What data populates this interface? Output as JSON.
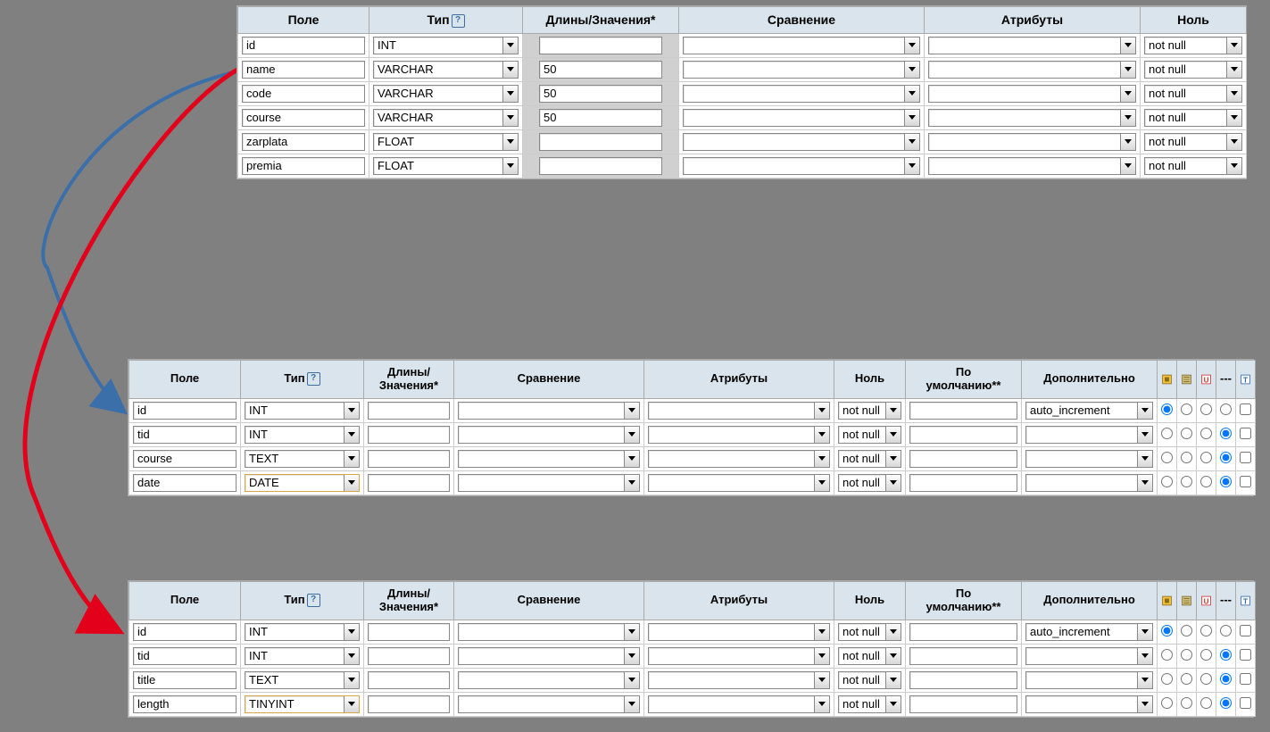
{
  "headers1": {
    "field": "Поле",
    "type": "Тип",
    "length": "Длины/Значения*",
    "collation": "Сравнение",
    "attributes": "Атрибуты",
    "null": "Ноль"
  },
  "headers2": {
    "field": "Поле",
    "type": "Тип",
    "length1": "Длины/",
    "length2": "Значения*",
    "collation": "Сравнение",
    "attributes": "Атрибуты",
    "null": "Ноль",
    "default1": "По",
    "default2": "умолчанию**",
    "extra": "Дополнительно",
    "dash": "---"
  },
  "table1": {
    "rows": [
      {
        "field": "id",
        "type": "INT",
        "length": "",
        "null": "not null"
      },
      {
        "field": "name",
        "type": "VARCHAR",
        "length": "50",
        "null": "not null"
      },
      {
        "field": "code",
        "type": "VARCHAR",
        "length": "50",
        "null": "not null"
      },
      {
        "field": "course",
        "type": "VARCHAR",
        "length": "50",
        "null": "not null"
      },
      {
        "field": "zarplata",
        "type": "FLOAT",
        "length": "",
        "null": "not null"
      },
      {
        "field": "premia",
        "type": "FLOAT",
        "length": "",
        "null": "not null"
      }
    ]
  },
  "table2": {
    "rows": [
      {
        "field": "id",
        "type": "INT",
        "null": "not null",
        "extra": "auto_increment",
        "hl": false,
        "sel": 0
      },
      {
        "field": "tid",
        "type": "INT",
        "null": "not null",
        "extra": "",
        "hl": false,
        "sel": 3
      },
      {
        "field": "course",
        "type": "TEXT",
        "null": "not null",
        "extra": "",
        "hl": false,
        "sel": 3
      },
      {
        "field": "date",
        "type": "DATE",
        "null": "not null",
        "extra": "",
        "hl": true,
        "sel": 3
      }
    ]
  },
  "table3": {
    "rows": [
      {
        "field": "id",
        "type": "INT",
        "null": "not null",
        "extra": "auto_increment",
        "hl": false,
        "sel": 0
      },
      {
        "field": "tid",
        "type": "INT",
        "null": "not null",
        "extra": "",
        "hl": false,
        "sel": 3
      },
      {
        "field": "title",
        "type": "TEXT",
        "null": "not null",
        "extra": "",
        "hl": false,
        "sel": 3
      },
      {
        "field": "length",
        "type": "TINYINT",
        "null": "not null",
        "extra": "",
        "hl": true,
        "sel": 3
      }
    ]
  }
}
